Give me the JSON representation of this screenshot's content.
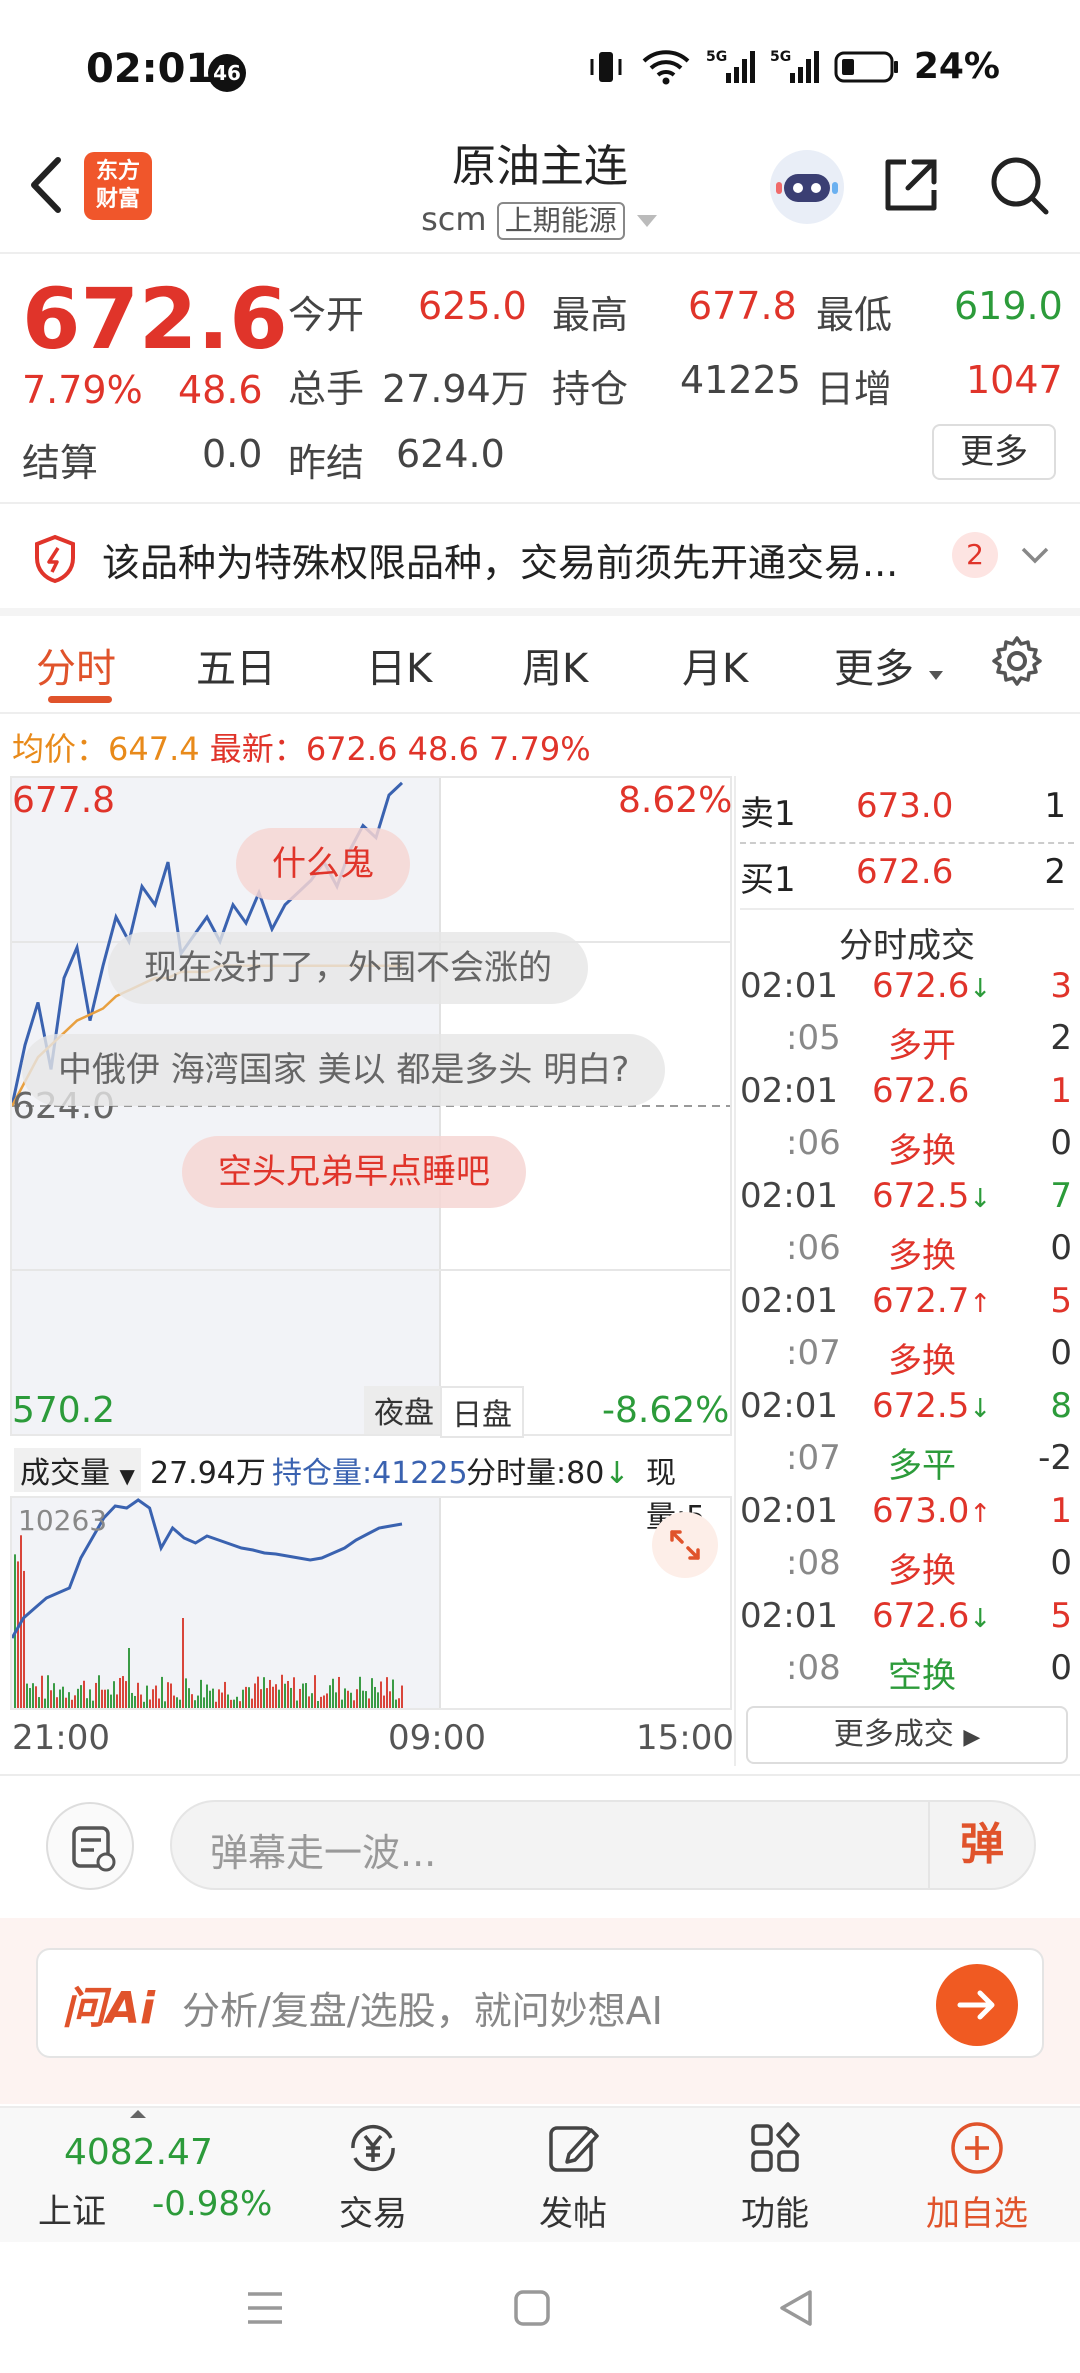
{
  "status_bar": {
    "time": "02:01",
    "badge": "46",
    "battery": "24%"
  },
  "header": {
    "logo_line1": "东方",
    "logo_line2": "财富",
    "title": "原油主连",
    "exchange_code": "scm",
    "exchange_name": "上期能源"
  },
  "quote": {
    "price": "672.6",
    "change_pct": "7.79%",
    "change": "48.6",
    "open_label": "今开",
    "open": "625.0",
    "high_label": "最高",
    "high": "677.8",
    "low_label": "最低",
    "low": "619.0",
    "volume_label": "总手",
    "volume": "27.94万",
    "oi_label": "持仓",
    "oi": "41225",
    "daily_inc_label": "日增",
    "daily_inc": "1047",
    "settle_label": "结算",
    "settle": "0.0",
    "prev_settle_label": "昨结",
    "prev_settle": "624.0",
    "more_label": "更多"
  },
  "notice": {
    "text": "该品种为特殊权限品种，交易前须先开通交易...",
    "count": "2"
  },
  "tabs": [
    {
      "label": "分时"
    },
    {
      "label": "五日"
    },
    {
      "label": "日K"
    },
    {
      "label": "周K"
    },
    {
      "label": "月K"
    },
    {
      "label": "更多"
    }
  ],
  "info_line": {
    "avg_label": "均价：",
    "avg": "647.4",
    "last_label": "最新：",
    "last": "672.6",
    "chg": "48.6",
    "pct": "7.79%"
  },
  "chart": {
    "top_price": "677.8",
    "top_pct": "8.62%",
    "mid_price": "624.0",
    "bottom_price": "570.2",
    "bottom_pct": "-8.62%",
    "session_night": "夜盘",
    "session_day": "日盘",
    "time_start": "21:00",
    "time_mid": "09:00",
    "time_end": "15:00"
  },
  "chart_data": {
    "type": "line",
    "ylim": [
      570.2,
      677.8
    ],
    "x_labels": [
      "21:00",
      "09:00",
      "15:00"
    ],
    "series": [
      {
        "name": "",
        "values": [
          624,
          634,
          641,
          630,
          645,
          650,
          638,
          647,
          655,
          651,
          660,
          657,
          664,
          649,
          652,
          655,
          651,
          657,
          654,
          659,
          653,
          657,
          659,
          661,
          664,
          660,
          666,
          670,
          668,
          675,
          677
        ]
      },
      {
        "name": "均价",
        "values": [
          624,
          628,
          632,
          634,
          636,
          638,
          639,
          640,
          642,
          643,
          644,
          645,
          645,
          646,
          646,
          646,
          647,
          647,
          647,
          647,
          647,
          647,
          647,
          647,
          647,
          647,
          647,
          647,
          647,
          647,
          647
        ]
      }
    ]
  },
  "danmaku": [
    "什么鬼",
    "现在没打了，外围不会涨的",
    "中俄伊 海湾国家 美以 都是多头 明白?",
    "空头兄弟早点睡吧"
  ],
  "volume": {
    "selector": "成交量",
    "total": "27.94万",
    "oi_label": "持仓量:41225",
    "interval": "分时量:80",
    "current_label": "现量:5",
    "max_label": "10263"
  },
  "order_book": [
    {
      "label": "卖1",
      "price": "673.0",
      "qty": "1"
    },
    {
      "label": "买1",
      "price": "672.6",
      "qty": "2"
    }
  ],
  "trades_title": "分时成交",
  "trades": [
    {
      "time": "02:01",
      "price": "672.6",
      "dir": "↓",
      "vol": "3",
      "sec": ":05",
      "type": "多开",
      "type_vol": "2"
    },
    {
      "time": "02:01",
      "price": "672.6",
      "dir": "",
      "vol": "1",
      "sec": ":06",
      "type": "多换",
      "type_vol": "0"
    },
    {
      "time": "02:01",
      "price": "672.5",
      "dir": "↓",
      "vol": "7",
      "sec": ":06",
      "type": "多换",
      "type_vol": "0"
    },
    {
      "time": "02:01",
      "price": "672.7",
      "dir": "↑",
      "vol": "5",
      "sec": ":07",
      "type": "多换",
      "type_vol": "0"
    },
    {
      "time": "02:01",
      "price": "672.5",
      "dir": "↓",
      "vol": "8",
      "sec": ":07",
      "type": "多平",
      "type_vol": "-2"
    },
    {
      "time": "02:01",
      "price": "673.0",
      "dir": "↑",
      "vol": "1",
      "sec": ":08",
      "type": "多换",
      "type_vol": "0"
    },
    {
      "time": "02:01",
      "price": "672.6",
      "dir": "↓",
      "vol": "5",
      "sec": ":08",
      "type": "空换",
      "type_vol": "0"
    }
  ],
  "more_trades": "更多成交",
  "danmu_input": {
    "placeholder": "弹幕走一波...",
    "send": "弹"
  },
  "ai_box": {
    "logo": "问Ai",
    "placeholder": "分析/复盘/选股，就问妙想AI"
  },
  "bottom_bar": {
    "index_value": "4082.47",
    "index_name": "上证",
    "index_change": "-0.98%",
    "items": [
      {
        "label": "交易"
      },
      {
        "label": "发帖"
      },
      {
        "label": "功能"
      },
      {
        "label": "加自选"
      }
    ]
  },
  "colors": {
    "up": "#e0342a",
    "down": "#2c9b3a",
    "accent": "#e0532b",
    "price_line": "#3a62b0",
    "avg_line": "#e8a040"
  }
}
